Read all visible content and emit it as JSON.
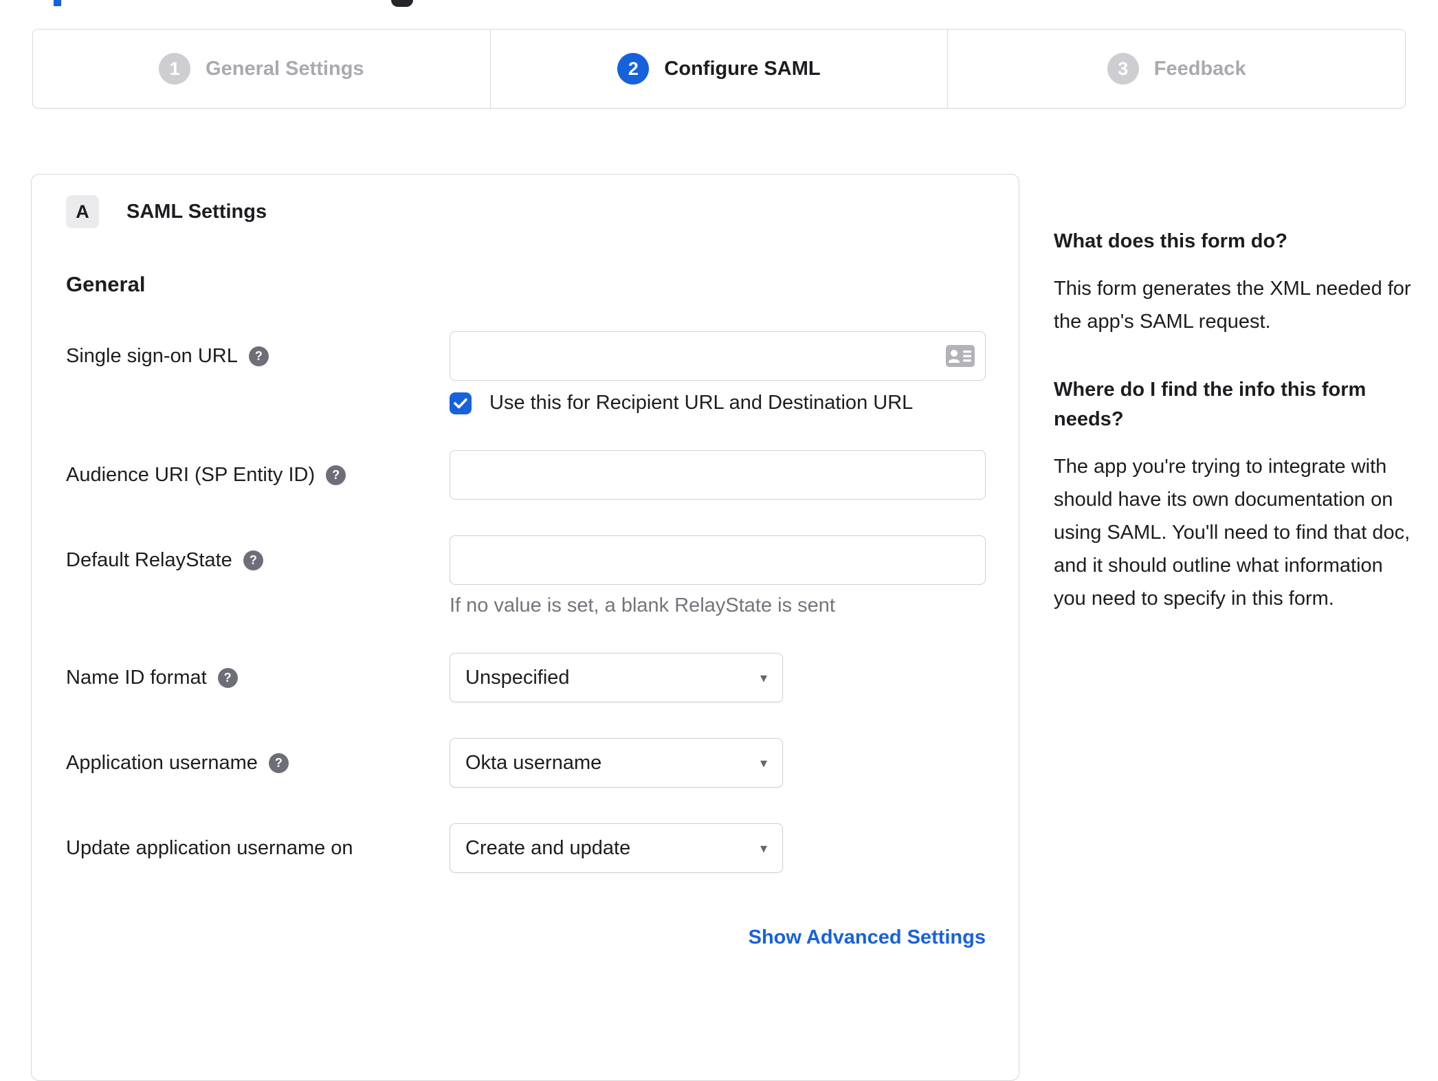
{
  "stepper": {
    "steps": [
      {
        "number": "1",
        "label": "General Settings",
        "state": "inactive"
      },
      {
        "number": "2",
        "label": "Configure SAML",
        "state": "active"
      },
      {
        "number": "3",
        "label": "Feedback",
        "state": "inactive"
      }
    ]
  },
  "panel": {
    "section_badge": "A",
    "section_title": "SAML Settings",
    "group_title": "General",
    "fields": {
      "sso_url": {
        "label": "Single sign-on URL",
        "value": "",
        "checkbox_label": "Use this for Recipient URL and Destination URL",
        "checked": true
      },
      "audience_uri": {
        "label": "Audience URI (SP Entity ID)",
        "value": ""
      },
      "relay_state": {
        "label": "Default RelayState",
        "value": "",
        "helper": "If no value is set, a blank RelayState is sent"
      },
      "name_id_format": {
        "label": "Name ID format",
        "value": "Unspecified"
      },
      "app_username": {
        "label": "Application username",
        "value": "Okta username"
      },
      "update_username": {
        "label": "Update application username on",
        "value": "Create and update"
      }
    },
    "advanced_link": "Show Advanced Settings"
  },
  "help": {
    "q1_title": "What does this form do?",
    "q1_body": "This form generates the XML needed for the app's SAML request.",
    "q2_title": "Where do I find the info this form needs?",
    "q2_body": "The app you're trying to integrate with should have its own documentation on using SAML. You'll need to find that doc, and it should outline what information you need to specify in this form."
  },
  "icons": {
    "help_glyph": "?",
    "caret_glyph": "▾"
  },
  "colors": {
    "accent_blue": "#1662dd",
    "border_gray": "#d8d8dc",
    "inactive_step_gray": "#cdcdd2",
    "muted_text": "#74747b"
  }
}
